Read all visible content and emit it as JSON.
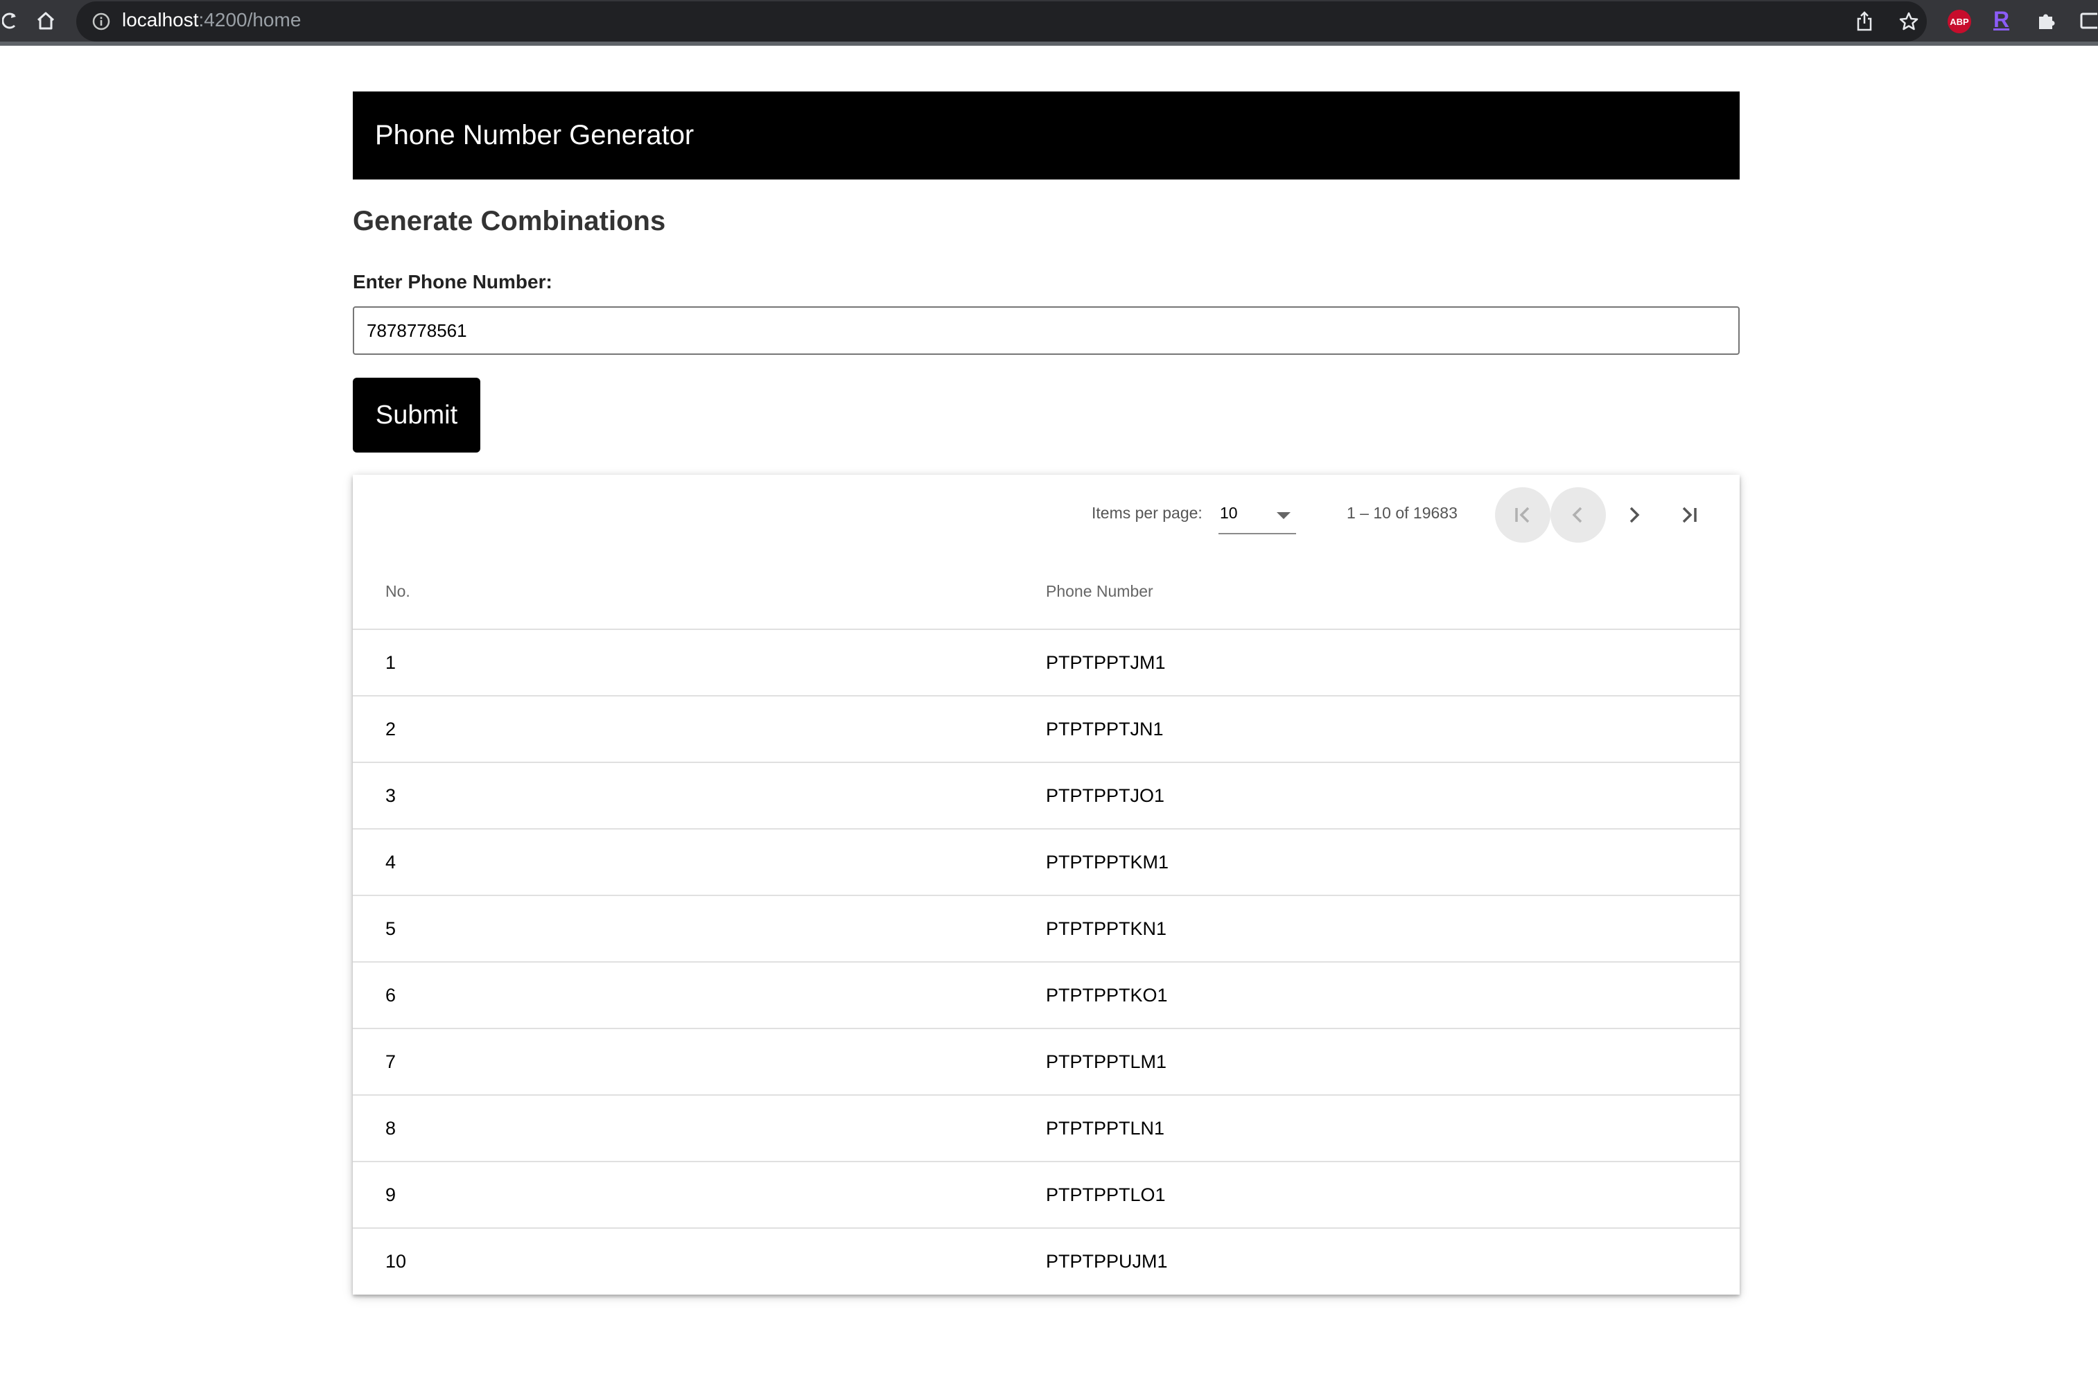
{
  "browser": {
    "url_host": "localhost",
    "url_path": ":4200/home",
    "extension_abp_label": "ABP",
    "extension_r_label": "R"
  },
  "app": {
    "title": "Phone Number Generator",
    "section_title": "Generate Combinations",
    "input_label": "Enter Phone Number:",
    "input_value": "7878778561",
    "submit_label": "Submit"
  },
  "paginator": {
    "items_per_page_label": "Items per page:",
    "items_per_page_value": "10",
    "range_label": "1 – 10 of 19683"
  },
  "table": {
    "columns": [
      "No.",
      "Phone Number"
    ],
    "rows": [
      {
        "no": "1",
        "phone": "PTPTPPTJM1"
      },
      {
        "no": "2",
        "phone": "PTPTPPTJN1"
      },
      {
        "no": "3",
        "phone": "PTPTPPTJO1"
      },
      {
        "no": "4",
        "phone": "PTPTPPTKM1"
      },
      {
        "no": "5",
        "phone": "PTPTPPTKN1"
      },
      {
        "no": "6",
        "phone": "PTPTPPTKO1"
      },
      {
        "no": "7",
        "phone": "PTPTPPTLM1"
      },
      {
        "no": "8",
        "phone": "PTPTPPTLN1"
      },
      {
        "no": "9",
        "phone": "PTPTPPTLO1"
      },
      {
        "no": "10",
        "phone": "PTPTPPUJM1"
      }
    ]
  }
}
